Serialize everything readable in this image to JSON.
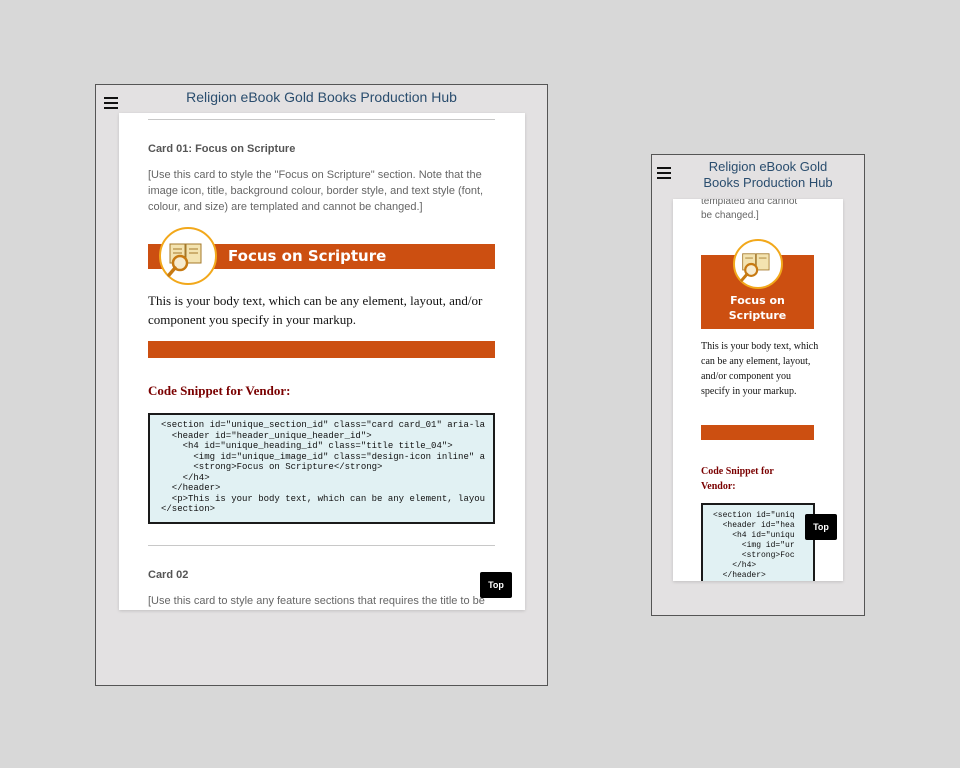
{
  "hub_title": "Religion eBook Gold Books Production Hub",
  "hub_title_small_line1": "Religion eBook Gold",
  "hub_title_small_line2": "Books Production Hub",
  "card01": {
    "title": "Card 01: Focus on Scripture",
    "description": "[Use this card to style the \"Focus on Scripture\" section. Note that the image icon, title, background colour, border style, and text style (font, colour, and size) are templated and cannot be changed.]",
    "description_small_tail_line1": "templated and cannot",
    "description_small_tail_line2": "be changed.]",
    "banner_title": "Focus on Scripture",
    "banner_title_line1": "Focus on",
    "banner_title_line2": "Scripture",
    "body_text": "This is your body text, which can be any element, layout, and/or component you specify in your markup.",
    "code_heading": "Code Snippet for Vendor:",
    "code_heading_line1": "Code Snippet for",
    "code_heading_line2": "Vendor:",
    "code_lines_large": [
      "<section id=\"unique_section_id\" class=\"card card_01\" aria-la",
      "  <header id=\"header_unique_header_id\">",
      "    <h4 id=\"unique_heading_id\" class=\"title title_04\">",
      "      <img id=\"unique_image_id\" class=\"design-icon inline\" a",
      "      <strong>Focus on Scripture</strong>",
      "    </h4>",
      "  </header>",
      "  <p>This is your body text, which can be any element, layou",
      "</section>"
    ],
    "code_lines_small": [
      "<section id=\"uniq",
      "  <header id=\"hea",
      "    <h4 id=\"uniqu",
      "      <img id=\"ur",
      "      <strong>Foc",
      "    </h4>",
      "  </header>"
    ]
  },
  "card02": {
    "title": "Card 02",
    "description": "[Use this card to style any feature sections that requires the title to be"
  },
  "top_label": "Top",
  "colors": {
    "accent_orange": "#cc4f11",
    "icon_ring": "#f2a81b",
    "code_bg": "#e1f1f3",
    "heading_red": "#7a0000",
    "title_blue": "#2a4d6e"
  },
  "icons": {
    "menu": "hamburger-menu-icon",
    "scripture": "book-magnifier-icon"
  }
}
